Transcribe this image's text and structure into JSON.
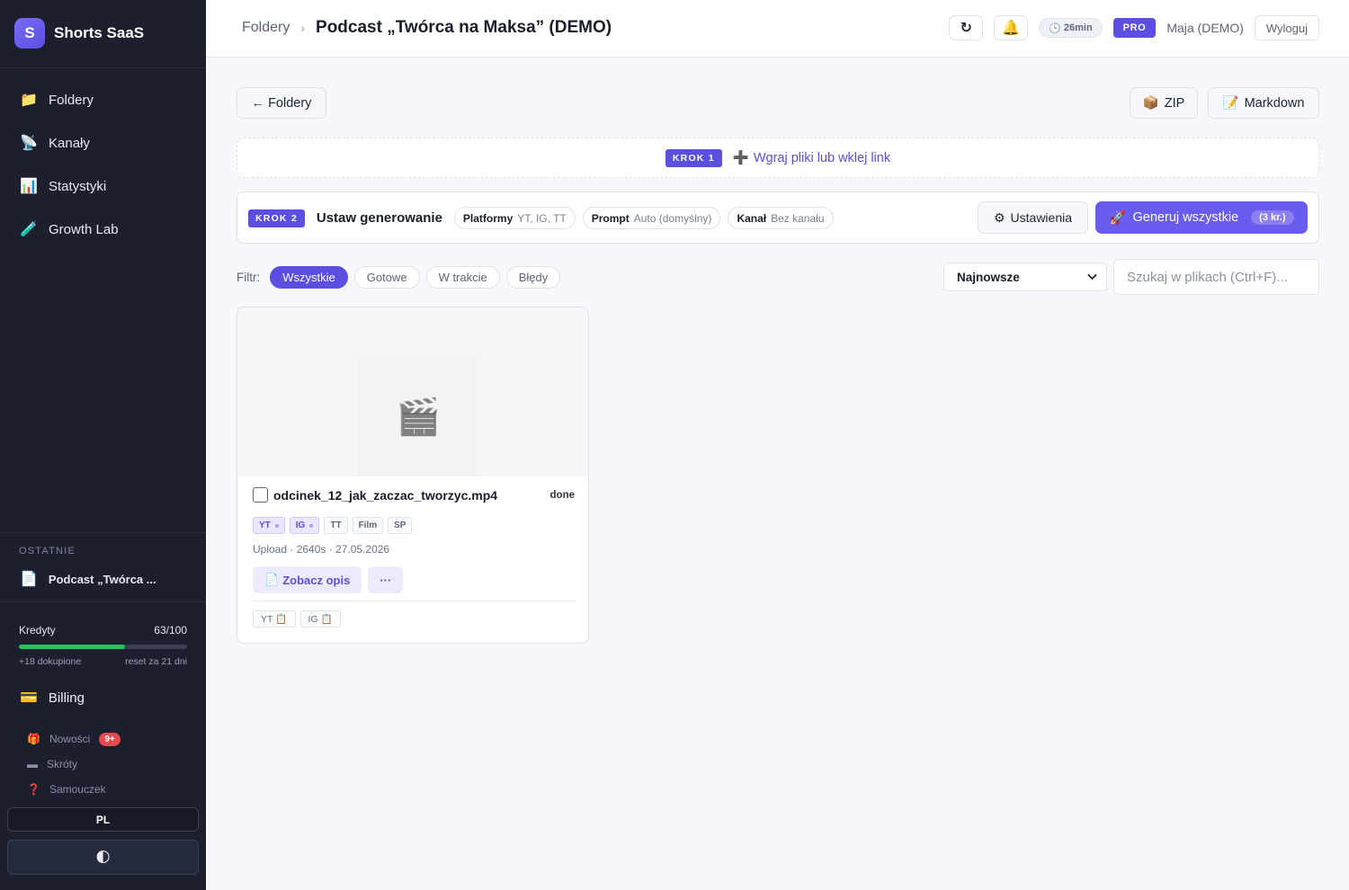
{
  "sidebar": {
    "brand_letter": "S",
    "brand_name": "Shorts SaaS",
    "nav": [
      {
        "icon": "📁",
        "label": "Foldery"
      },
      {
        "icon": "📡",
        "label": "Kanały"
      },
      {
        "icon": "📊",
        "label": "Statystyki"
      },
      {
        "icon": "🧪",
        "label": "Growth Lab"
      }
    ],
    "recent_label": "OSTATNIE",
    "recent_item": {
      "icon": "📄",
      "label": "Podcast „Twórca ..."
    },
    "credits": {
      "label": "Kredyty",
      "value": "63/100",
      "fraction": 0.63,
      "bought": "+18 dokupione",
      "reset": "reset za 21 dni"
    },
    "billing": {
      "icon": "💳",
      "label": "Billing"
    },
    "small_links": [
      {
        "icon": "🎁",
        "label": "Nowości",
        "badge": "9+"
      },
      {
        "icon": "▬",
        "label": "Skróty"
      },
      {
        "icon": "❓",
        "label": "Samouczek"
      }
    ],
    "lang": "PL",
    "theme_icon": "🌓"
  },
  "header": {
    "breadcrumb_parent": "Foldery",
    "breadcrumb_sep": "›",
    "title": "Podcast „Twórca na Maksa” (DEMO)",
    "refresh_icon": "↻",
    "bell_icon": "🔔",
    "time_icon": "🕒",
    "time": "26min",
    "plan": "PRO",
    "user": "Maja (DEMO)",
    "logout": "Wyloguj"
  },
  "toolbar": {
    "back": "← Foldery",
    "zip_icon": "📦",
    "zip": "ZIP",
    "md_icon": "📝",
    "md": "Markdown"
  },
  "step1": {
    "badge": "KROK 1",
    "icon": "➕",
    "link": "Wgraj pliki lub wklej link"
  },
  "step2": {
    "badge": "KROK 2",
    "title": "Ustaw generowanie",
    "chips": [
      {
        "key": "Platformy",
        "value": "YT, IG, TT"
      },
      {
        "key": "Prompt",
        "value": "Auto (domyślny)"
      },
      {
        "key": "Kanał",
        "value": "Bez kanału"
      }
    ],
    "settings_icon": "⚙",
    "settings": "Ustawienia",
    "generate_icon": "🚀",
    "generate": "Generuj wszystkie",
    "cost": "(3 kr.)"
  },
  "filters": {
    "label": "Filtr:",
    "items": [
      "Wszystkie",
      "Gotowe",
      "W trakcie",
      "Błędy"
    ],
    "active": "Wszystkie",
    "sort": "Najnowsze",
    "search_placeholder": "Szukaj w plikach (Ctrl+F)..."
  },
  "card": {
    "thumb_icon": "🎬",
    "filename": "odcinek_12_jak_zaczac_tworzyc.mp4",
    "status": "done",
    "tags": [
      {
        "label": "YT",
        "active": true
      },
      {
        "label": "IG",
        "active": true
      },
      {
        "label": "TT",
        "active": false
      },
      {
        "label": "Film",
        "active": false
      },
      {
        "label": "SP",
        "active": false
      }
    ],
    "meta": "Upload · 2640s · 27.05.2026",
    "view_icon": "📄",
    "view": "Zobacz opis",
    "more": "···",
    "copy": [
      {
        "label": "YT",
        "icon": "📋"
      },
      {
        "label": "IG",
        "icon": "📋"
      }
    ]
  }
}
